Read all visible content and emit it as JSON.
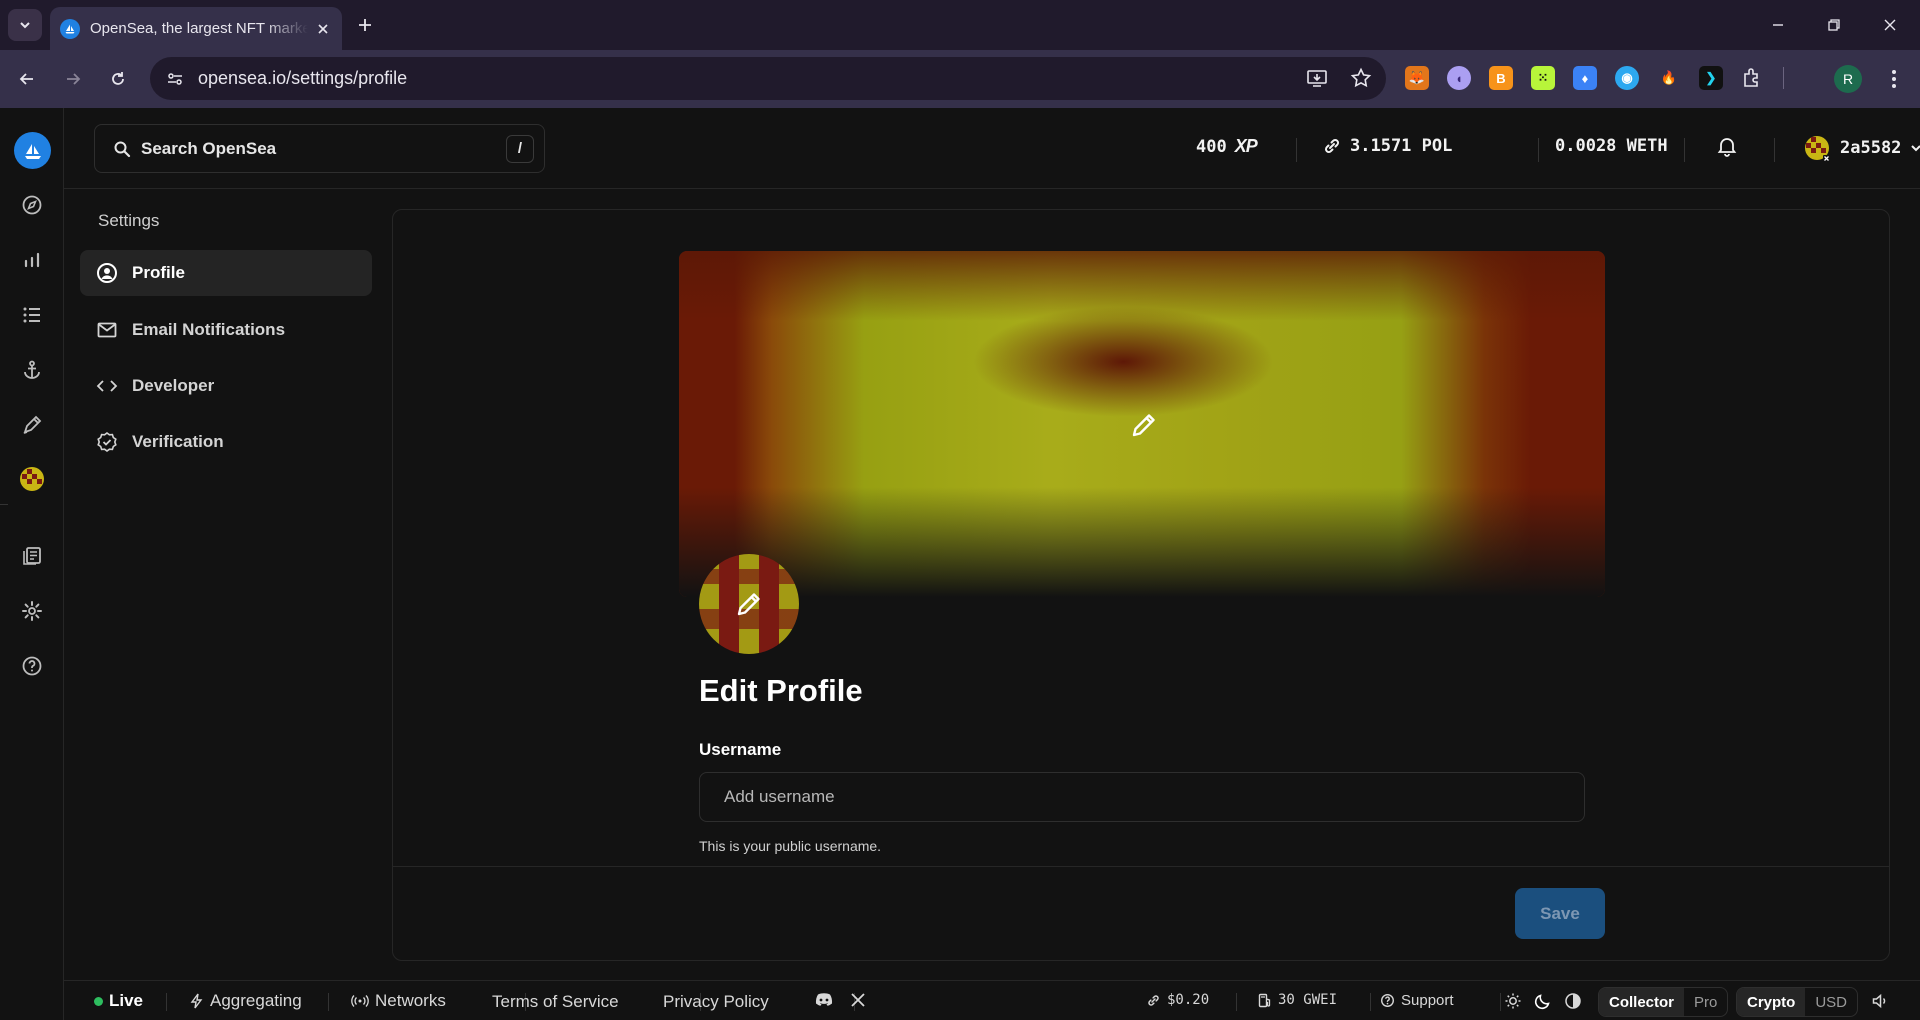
{
  "browser": {
    "tab_title": "OpenSea, the largest NFT marketplace",
    "url": "opensea.io/settings/profile",
    "profile_initial": "R"
  },
  "topbar": {
    "search_placeholder": "Search OpenSea",
    "search_shortcut": "/",
    "xp_value": "400",
    "xp_label": "XP",
    "pol_balance": "3.1571 POL",
    "weth_balance": "0.0028 WETH",
    "account_name": "2a5582"
  },
  "settings_nav": {
    "title": "Settings",
    "items": [
      {
        "label": "Profile",
        "icon": "user-circle-icon",
        "active": true
      },
      {
        "label": "Email Notifications",
        "icon": "mail-icon",
        "active": false
      },
      {
        "label": "Developer",
        "icon": "code-icon",
        "active": false
      },
      {
        "label": "Verification",
        "icon": "badge-check-icon",
        "active": false
      }
    ]
  },
  "profile_form": {
    "title": "Edit Profile",
    "username_label": "Username",
    "username_value": "",
    "username_placeholder": "Add username",
    "username_help": "This is your public username.",
    "save_label": "Save"
  },
  "statusbar": {
    "live": "Live",
    "aggregating": "Aggregating",
    "networks": "Networks",
    "terms": "Terms of Service",
    "privacy": "Privacy Policy",
    "pol_price": "$0.20",
    "gas": "30 GWEI",
    "support": "Support",
    "mode_collector": "Collector",
    "mode_pro": "Pro",
    "currency_crypto": "Crypto",
    "currency_usd": "USD"
  },
  "colors": {
    "accent": "#2081e2",
    "background": "#121212",
    "live": "#2ebd5f",
    "save_button": "#1b4f7e"
  }
}
